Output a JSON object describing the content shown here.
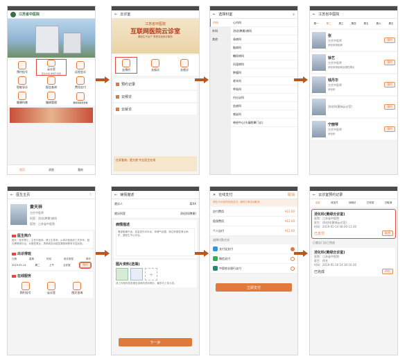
{
  "colors": {
    "accent": "#e07a3c",
    "highlight": "#e4473e",
    "status_bar": "#4a4a4a"
  },
  "s1": {
    "hospital_title": "江苏省中医院",
    "menu": [
      "预约挂号",
      "云诊室",
      "远程会诊",
      "智能导诊",
      "报告查询",
      "费用支付",
      "健康科普",
      "慢病管理",
      "糖尿病健康讲堂"
    ],
    "cloud_sub": "医生在线 看病不用跑",
    "tabs": [
      "首页",
      "消息",
      "我的"
    ]
  },
  "s2": {
    "title": "云诊室",
    "banner_title": "江苏省中医院",
    "banner_main": "互联网医院云诊室",
    "banner_sub": "看医生不出户 享受名医就诊服务",
    "icons": [
      "去预约",
      "去候诊",
      "去就诊"
    ],
    "list": [
      "预约记录",
      "云候诊",
      "云就诊"
    ],
    "footer_text": "在家看病，更方便 专业医生在线"
  },
  "s3": {
    "title": "选择科室",
    "left": [
      "内科",
      "外科",
      "其他"
    ],
    "right": [
      "心内科",
      "消化(脾胃)病科",
      "肾病科",
      "脑病科",
      "糖尿病科",
      "风湿病科",
      "肿瘤科",
      "老年科",
      "呼吸科",
      "内分泌科",
      "血液科",
      "感染科",
      "神经中心(头痛眩晕门诊)"
    ]
  },
  "s4": {
    "title": "江苏省中医院",
    "days": [
      "周一",
      "周二",
      "周三",
      "周四",
      "周五",
      "周六",
      "周日"
    ],
    "doctors": [
      {
        "name": "张",
        "title": "主任中医师",
        "desc": "消化系统疾病",
        "btn": "预约"
      },
      {
        "name": "徐艺",
        "title": "主任中医师",
        "desc": "消化系统疾病及慢性胃炎",
        "btn": "预约"
      },
      {
        "name": "钱丹华",
        "title": "主任中医师",
        "desc": "消化科",
        "btn": "预约"
      },
      {
        "name": "",
        "title": "消化科(黄绿云诊室)",
        "desc": "",
        "btn": "预约"
      },
      {
        "name": "宁丽琴",
        "title": "主任中医师",
        "desc": "消化科",
        "btn": "预约"
      }
    ]
  },
  "s5": {
    "title": "医生主页",
    "doc_name": "黄天祥",
    "doc_title": "主任中医师",
    "doc_dept": "科室：消化(脾胃)病科",
    "doc_hosp": "医院：江苏省中医院",
    "sec_intro": "医生简介",
    "intro_text": "擅长：医学博士，主任中医师，博士生导师，从事中医临床工作多年，擅长脾胃病诊治，对慢性胃炎、溃疡病及功能性胃肠病等有丰富经验。",
    "sec_sched": "出诊排班",
    "sched_head": [
      "日期",
      "星期",
      "时段",
      "就诊类型",
      "操作"
    ],
    "sched_row": [
      "2019-05-14",
      "周二",
      "上午",
      "云诊室",
      "预约"
    ],
    "sec_serv": "在线服务",
    "services": [
      "预约挂号",
      "云诊室",
      "图文咨询"
    ]
  },
  "s6": {
    "title": "病情描述",
    "patient_label": "就诊人",
    "patient_value": "蒋XX",
    "dept_label": "就诊科室",
    "dept_value": "消化科(脾胃)",
    "desc_label": "病情描述",
    "desc_text": "胃部胀痛不适，反复发作半年余，伴嗳气反酸，既往有慢性胃炎病史，望医生予以诊治。",
    "img_label": "图片资料(选填)",
    "img_note": "请上传相关检查报告或病历资料照片，最多可上传九张。",
    "next_btn": "下一步"
  },
  "s7": {
    "title": "在线支付",
    "cancel": "取消",
    "notice": "请在15分钟内完成支付，超时订单自动取消",
    "rows": [
      {
        "label": "应付费用",
        "value": "¥12.00"
      },
      {
        "label": "医保费用",
        "value": "¥12.00"
      },
      {
        "label": "个人自付",
        "value": "¥12.00"
      }
    ],
    "method_label": "选择付款方式",
    "methods": [
      "支付宝支付",
      "微信支付",
      "中国农业银行支付"
    ],
    "pay_btn": "立即支付"
  },
  "s8": {
    "title": "云诊室预约记录",
    "tabs": [
      "全部",
      "待支付",
      "待就诊",
      "已完成",
      "已取消"
    ],
    "rec1_dept": "消化科(黄绿云诊室)",
    "rec1_hosp": "医院：江苏省中医院",
    "rec1_doc": "医生：消化科(黄绿云诊室)",
    "rec1_time": "时间：2019-05-14 08:00-11:30",
    "status": "已支付",
    "cancel_btn": "取消",
    "section2": "已就诊门诊已完成",
    "rec2_dept": "消化科(黄绿云诊室)",
    "rec2_hosp": "医院：江苏省中医院",
    "rec2_doc": "医生：徐艺",
    "rec2_time": "时间：2019-05-10 14:30-16:30",
    "status2": "已完成",
    "btn2": "评价"
  }
}
